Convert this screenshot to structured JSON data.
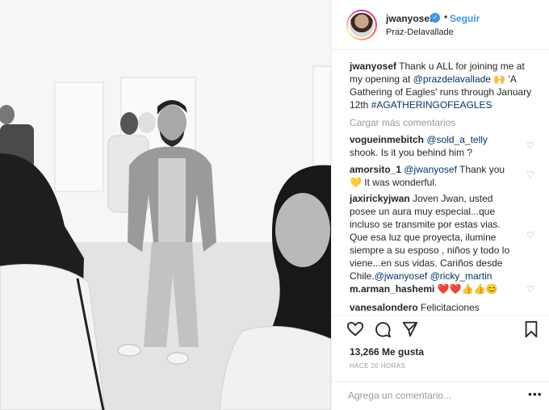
{
  "header": {
    "username": "jwanyosef",
    "verified_mark": "✓",
    "separator": "•",
    "follow_label": "Seguir",
    "location": "Praz-Delavallade"
  },
  "caption": {
    "username": "jwanyosef",
    "text_1": "Thank u ALL for joining me at my opening at ",
    "mention": "@prazdelavallade",
    "emoji": "🙌",
    "text_2": " 'A Gathering of Eagles' runs through January 12th ",
    "hashtag": "#AGATHERINGOFEAGLES"
  },
  "load_more_label": "Cargar más comentarios",
  "comments": [
    {
      "username": "vogueinmebitch",
      "mention": "@sold_a_telly",
      "text": " shook. Is it you behind him ?"
    },
    {
      "username": "amorsito_1",
      "mention": "@jwanyosef",
      "text": " Thank you ",
      "emoji": "💛",
      "text_after": " It was wonderful."
    },
    {
      "username": "jaxiricky​jwan",
      "text": "Joven Jwan, usted posee un aura muy especial...que incluso se transmite por estas vias. Que esa luz que proyecta, ilumine siempre a su esposo , niños y todo lo viene...en sus vidas. Cariños desde Chile.",
      "mention": "@jwanyosef",
      "mention2": "@ricky_martin"
    },
    {
      "username": "m.arman_hashemi",
      "emoji": "❤️❤️👍👍😊"
    },
    {
      "username": "vanesalondero",
      "text": "Felicitaciones"
    }
  ],
  "icons": {
    "like": "heart-outline-icon",
    "comment": "comment-bubble-icon",
    "share": "share-arrow-icon",
    "save": "bookmark-icon",
    "more": "more-dots-icon"
  },
  "likes_label": "13,266 Me gusta",
  "timestamp": "HACE 20 HORAS",
  "add_comment": {
    "placeholder": "Agrega un comentario...",
    "more": "•••"
  },
  "comment_like_glyph": "♡"
}
